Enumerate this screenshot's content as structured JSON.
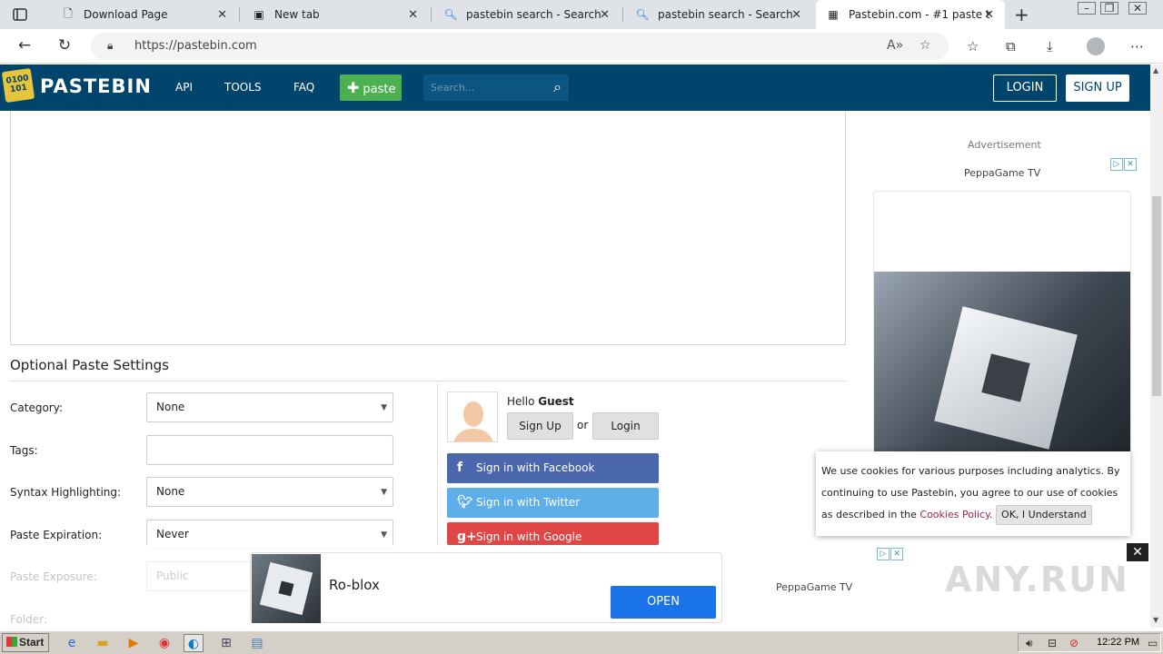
{
  "browser": {
    "tabs": [
      {
        "title": "Download Page",
        "icon": "page-icon"
      },
      {
        "title": "New tab",
        "icon": "newtab-icon"
      },
      {
        "title": "pastebin search - Search",
        "icon": "search-icon"
      },
      {
        "title": "pastebin search - Search",
        "icon": "search-icon"
      },
      {
        "title": "Pastebin.com - #1 paste t",
        "icon": "pastebin-icon",
        "active": true
      }
    ],
    "url": "https://pastebin.com"
  },
  "header": {
    "brand": "PASTEBIN",
    "nav": [
      "API",
      "TOOLS",
      "FAQ"
    ],
    "paste_label": "paste",
    "search_placeholder": "Search...",
    "login_label": "LOGIN",
    "signup_label": "SIGN UP",
    "bg_color": "#02456c",
    "paste_color": "#4caf50"
  },
  "settings": {
    "title": "Optional Paste Settings",
    "category_label": "Category:",
    "category_value": "None",
    "tags_label": "Tags:",
    "syntax_label": "Syntax Highlighting:",
    "syntax_value": "None",
    "expiration_label": "Paste Expiration:",
    "expiration_value": "Never",
    "exposure_label": "Paste Exposure:",
    "exposure_value": "Public",
    "folder_label": "Folder:"
  },
  "guest": {
    "hello": "Hello",
    "name": "Guest",
    "signup_label": "Sign Up",
    "or": "or",
    "login_label": "Login",
    "facebook": "Sign in with Facebook",
    "twitter": "Sign in with Twitter",
    "google": "Sign in with Google",
    "facebook_color": "#4a67ad",
    "twitter_color": "#5eaee9",
    "google_color": "#e04646"
  },
  "sidebar_ad": {
    "label": "Advertisement",
    "name": "PeppaGame TV"
  },
  "cookie": {
    "text": "We use cookies for various purposes including analytics. By continuing to use Pastebin, you agree to our use of cookies as described in the",
    "policy_link": "Cookies Policy",
    "period": ".",
    "ok_label": "OK, I Understand"
  },
  "bottom_ad": {
    "app_name": "Ro-blox",
    "open_label": "OPEN",
    "name": "PeppaGame TV",
    "watermark": "ANY.RUN"
  },
  "taskbar": {
    "start_label": "Start",
    "clock": "12:22 PM"
  }
}
